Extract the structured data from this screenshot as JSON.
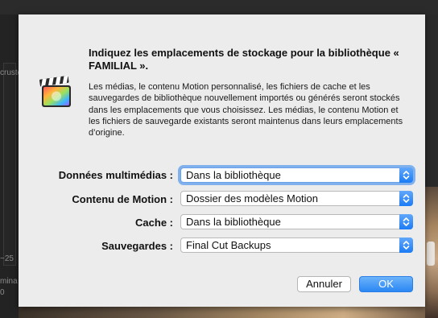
{
  "background": {
    "fragments": [
      "cruste",
      "−25",
      "mina",
      "0"
    ]
  },
  "dialog": {
    "icon": "final-cut-pro-clapperboard-icon",
    "title": "Indiquez les emplacements de stockage pour la bibliothèque « FAMILIAL ».",
    "description": "Les médias, le contenu Motion personnalisé, les fichiers de cache et les sauvegardes de bibliothèque nouvellement importés ou générés seront stockés dans les emplacements que vous choisissez. Les médias, le contenu Motion et les fichiers de sauvegarde existants seront maintenus dans leurs emplacements d’origine.",
    "rows": [
      {
        "label": "Données multimédias :",
        "value": "Dans la bibliothèque"
      },
      {
        "label": "Contenu de Motion :",
        "value": "Dossier des modèles Motion"
      },
      {
        "label": "Cache :",
        "value": "Dans la bibliothèque"
      },
      {
        "label": "Sauvegardes :",
        "value": "Final Cut Backups"
      }
    ],
    "buttons": {
      "cancel": "Annuler",
      "ok": "OK"
    },
    "accent_color": "#1b7cf5"
  }
}
